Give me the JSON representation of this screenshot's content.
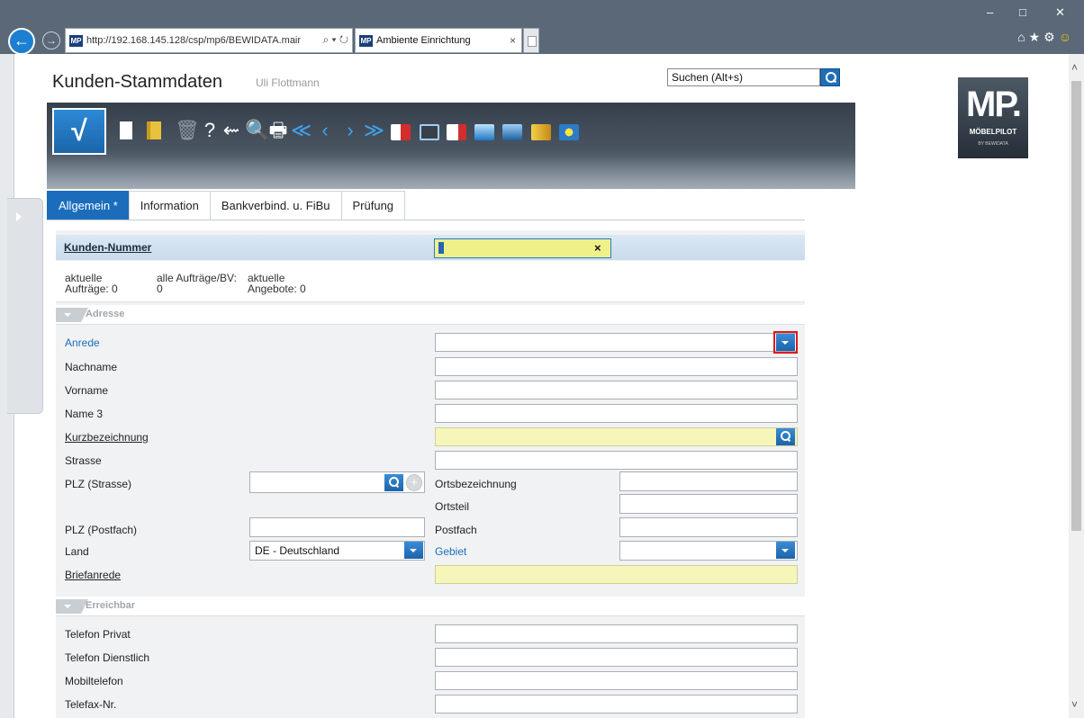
{
  "browser": {
    "url": "http://192.168.145.128/csp/mp6/BEWIDATA.main",
    "url_visible": "http://192.168.145.128/csp/mp6/BEWIDATA.mair",
    "favicon_text": "MP",
    "tab_title": "Ambiente Einrichtung",
    "tab_close": "×"
  },
  "app": {
    "title": "Kunden-Stammdaten",
    "user": "Uli Flottmann",
    "search_placeholder": "Suchen (Alt+s)",
    "confirm_symbol": "√",
    "logo_main": "MP.",
    "logo_sub": "MÖBELPILOT",
    "logo_by": "BY BEWIDATA"
  },
  "tabs": [
    {
      "label": "Allgemein *",
      "active": true
    },
    {
      "label": "Information",
      "active": false
    },
    {
      "label": "Bankverbind. u. FiBu",
      "active": false
    },
    {
      "label": "Prüfung",
      "active": false
    }
  ],
  "header_row": {
    "label": "Kunden-Nummer",
    "value_cursor": "+",
    "clear": "×"
  },
  "stats": {
    "a_line1": "aktuelle",
    "a_line2": "Aufträge: 0",
    "b_line1": "alle Aufträge/BV:",
    "b_line2": "0",
    "c_line1": "aktuelle",
    "c_line2": "Angebote: 0"
  },
  "sections": {
    "adresse": "Adresse",
    "erreichbar": "Erreichbar"
  },
  "fields": {
    "anrede": "Anrede",
    "nachname": "Nachname",
    "vorname": "Vorname",
    "name3": "Name 3",
    "kurzbezeichnung": "Kurzbezeichnung",
    "strasse": "Strasse",
    "plz_strasse": "PLZ (Strasse)",
    "ortsbezeichnung": "Ortsbezeichnung",
    "ortsteil": "Ortsteil",
    "plz_postfach": "PLZ (Postfach)",
    "postfach": "Postfach",
    "land": "Land",
    "land_value": "DE - Deutschland",
    "gebiet": "Gebiet",
    "briefanrede": "Briefanrede",
    "telefon_privat": "Telefon Privat",
    "telefon_dienstlich": "Telefon Dienstlich",
    "mobiltelefon": "Mobiltelefon",
    "telefax": "Telefax-Nr."
  },
  "colors": {
    "accent": "#1b6dbc",
    "highlight_outline": "#e0171b",
    "required_field": "#f6f6ba"
  }
}
